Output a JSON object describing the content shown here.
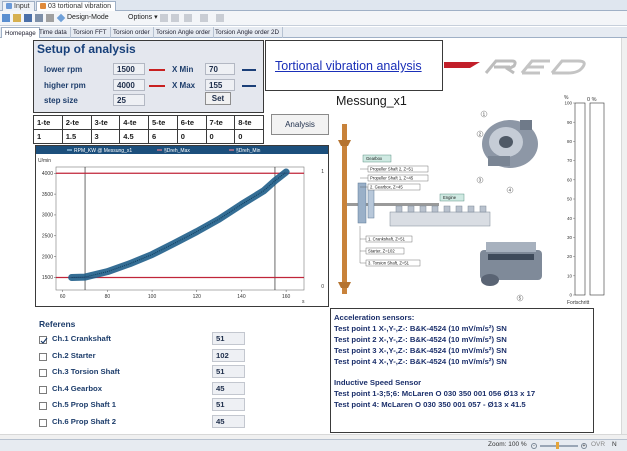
{
  "window_tabs": [
    {
      "label": "Input",
      "active": false
    },
    {
      "label": "03 tortional vibration",
      "active": true
    }
  ],
  "toolbar": {
    "design_mode_label": "Design-Mode",
    "options_label": "Options"
  },
  "page_tabs": [
    "Homepage",
    "Time data",
    "Torsion FFT",
    "Torsion order",
    "Torsion Angle order",
    "Torsion Angle order 2D"
  ],
  "setup": {
    "title": "Setup of analysis",
    "lower_rpm_label": "lower rpm",
    "lower_rpm_value": "1500",
    "higher_rpm_label": "higher rpm",
    "higher_rpm_value": "4000",
    "step_size_label": "step size",
    "step_size_value": "25",
    "xmin_label": "X Min",
    "xmin_value": "70",
    "xmax_label": "X Max",
    "xmax_value": "155",
    "set_label": "Set"
  },
  "title_link": "Tortional vibration analysis",
  "order_table": {
    "headers": [
      "1-te",
      "2-te",
      "3-te",
      "4-te",
      "5-te",
      "6-te",
      "7-te",
      "8-te"
    ],
    "values": [
      "1",
      "1.5",
      "3",
      "4.5",
      "6",
      "0",
      "0",
      "0"
    ]
  },
  "analysis_label": "Analysis",
  "chart_data": {
    "type": "line",
    "legend": [
      "RPM_KW @ Messung_x1",
      "§Dreh_Max",
      "§Dreh_Min"
    ],
    "ylabel": "U/min",
    "xlabel": "s",
    "x_ticks": [
      "60",
      "80",
      "100",
      "120",
      "140",
      "160"
    ],
    "y_ticks": [
      "1500",
      "2000",
      "2500",
      "3000",
      "3500",
      "4000"
    ],
    "right_ticks": [
      "1",
      "0"
    ],
    "xlim": [
      57,
      168
    ],
    "ylim": [
      1200,
      4150
    ],
    "series": [
      {
        "name": "RPM_KW @ Messung_x1",
        "x": [
          64,
          70,
          80,
          90,
          100,
          110,
          120,
          130,
          140,
          150,
          155,
          160
        ],
        "y": [
          1500,
          1510,
          1640,
          1830,
          2050,
          2320,
          2600,
          2900,
          3250,
          3580,
          3820,
          4030
        ]
      },
      {
        "name": "§Dreh_Max",
        "x": [
          57,
          168
        ],
        "y": [
          4000,
          4000
        ]
      },
      {
        "name": "§Dreh_Min",
        "x": [
          57,
          168
        ],
        "y": [
          1500,
          1500
        ]
      }
    ],
    "cursor_x": [
      70,
      155
    ],
    "colors": {
      "signal": "#1f5e8a",
      "limits": "#c0253a",
      "header": "#1c4f7c"
    }
  },
  "diagram": {
    "title": "Messung_x1",
    "labels": [
      "Gearbox",
      "Propeller Shaft 2, Z=51",
      "Propeller Shaft 1, Z=45",
      "2. Gearbox, Z=45",
      "Engine",
      "1. Crankshaft, Z=51",
      "Starter, Z=102",
      "3. Torsion Shaft, Z=51"
    ],
    "callouts": [
      "1",
      "2",
      "3",
      "4",
      "5"
    ]
  },
  "gauge": {
    "percent_label": "%",
    "value_label": "0 %",
    "ticks": [
      "100",
      "90",
      "80",
      "70",
      "60",
      "50",
      "40",
      "30",
      "20",
      "10",
      "0"
    ],
    "footer": "Fortschritt",
    "level": 0
  },
  "referens": {
    "title": "Referens",
    "rows": [
      {
        "label": "Ch.1 Crankshaft",
        "value": "51",
        "checked": true
      },
      {
        "label": "Ch.2 Starter",
        "value": "102",
        "checked": false
      },
      {
        "label": "Ch.3 Torsion Shaft",
        "value": "51",
        "checked": false
      },
      {
        "label": "Ch.4 Gearbox",
        "value": "45",
        "checked": false
      },
      {
        "label": "Ch.5 Prop Shaft 1",
        "value": "51",
        "checked": false
      },
      {
        "label": "Ch.6 Prop Shaft 2",
        "value": "45",
        "checked": false
      }
    ]
  },
  "sensors": {
    "accel_title": "Acceleration sensors:",
    "accel_lines": [
      "Test point 1 X-,Y-,Z-: B&K-4524 (10 mV/m/s²) SN",
      "Test point 2 X-,Y-,Z-: B&K-4524 (10 mV/m/s²) SN",
      "Test point 3 X-,Y-,Z-: B&K-4524 (10 mV/m/s²) SN",
      "Test point 4 X-,Y-,Z-: B&K-4524 (10 mV/m/s²) SN"
    ],
    "speed_title": "Inductive Speed Sensor",
    "speed_lines": [
      "Test point 1-3;5;6: McLaren O 030 350 001 056 Ø13 x 17",
      "Test point 4: McLaren O 030 350 001 057 - Ø13 x 41.5"
    ]
  },
  "statusbar": {
    "zoom_label": "Zoom: 100 %",
    "ovr_label": "OVR",
    "num_label": "N"
  }
}
